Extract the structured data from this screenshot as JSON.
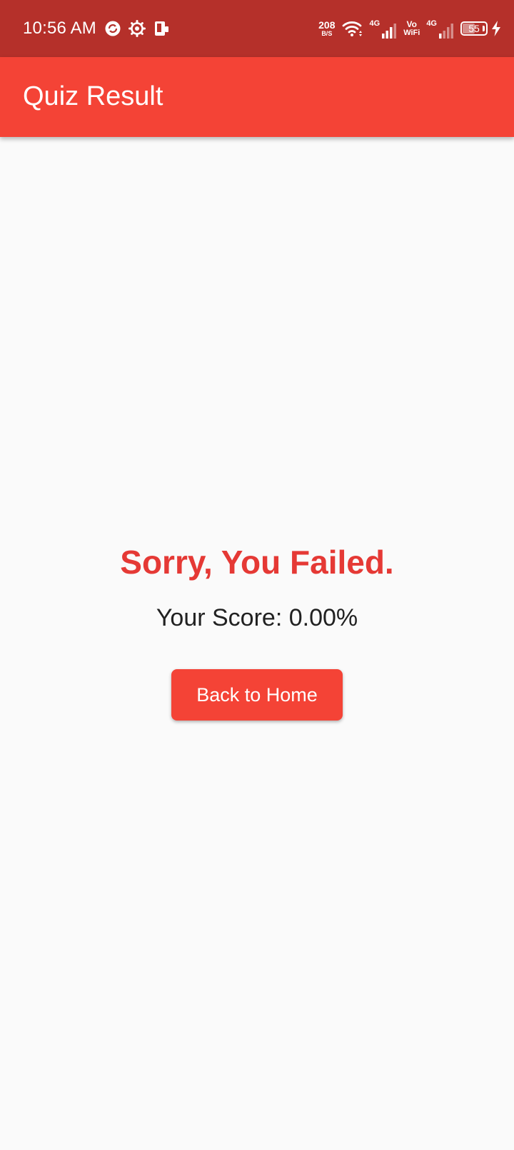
{
  "status_bar": {
    "time": "10:56 AM",
    "left_icons": [
      "sync-app-icon",
      "gear-icon",
      "device-icon"
    ],
    "net_speed_value": "208",
    "net_speed_unit": "B/S",
    "sim1_label": "4G",
    "vowifi_top": "Vo",
    "vowifi_bottom": "WiFi",
    "sim2_label": "4G",
    "battery_level": "55",
    "battery_percent": 55,
    "charging_icon": "lightning-icon",
    "bar_color": "#b5302a"
  },
  "app_bar": {
    "title": "Quiz Result",
    "color": "#f44336"
  },
  "result": {
    "heading": "Sorry, You Failed.",
    "heading_color": "#e53935",
    "score": "Your Score: 0.00%",
    "home_button_label": "Back to Home"
  }
}
